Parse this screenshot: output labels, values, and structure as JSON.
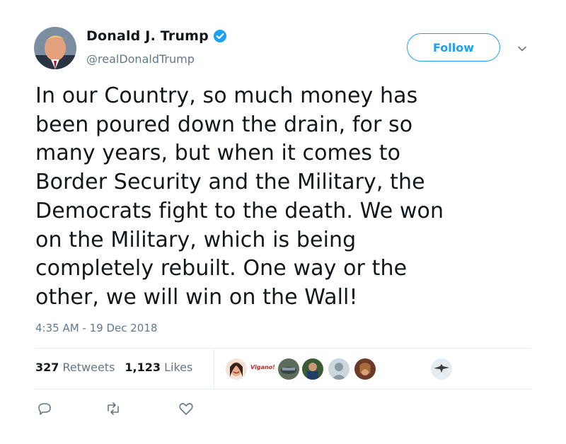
{
  "header": {
    "display_name": "Donald J. Trump",
    "handle": "@realDonaldTrump",
    "follow_label": "Follow",
    "verified": true,
    "accent_color": "#1da1f2"
  },
  "tweet": {
    "lines": [
      "In our Country, so much money has",
      "been poured down the drain, for so",
      "many years, but when it comes to",
      "Border Security and the Military, the",
      "Democrats fight to the death. We won",
      "on the Military, which is being",
      "completely rebuilt. One way or the",
      "other, we will win on the Wall!"
    ],
    "timestamp": "4:35 AM - 19 Dec 2018"
  },
  "stats": {
    "retweets_count": "327",
    "retweets_label": "Retweets",
    "likes_count": "1,123",
    "likes_label": "Likes"
  },
  "likers": {
    "text_avatar_label": "Vigano!"
  },
  "actions": [
    "reply-icon",
    "retweet-icon",
    "like-icon"
  ]
}
